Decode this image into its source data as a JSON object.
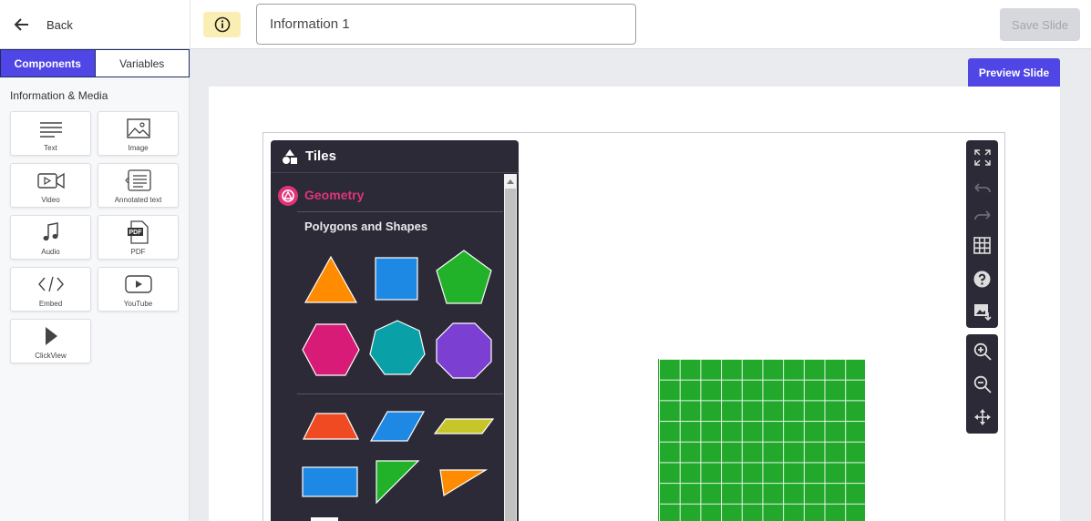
{
  "header": {
    "back_label": "Back",
    "title_value": "Information 1",
    "save_label": "Save Slide"
  },
  "sidebar": {
    "tabs": [
      {
        "label": "Components",
        "active": true
      },
      {
        "label": "Variables",
        "active": false
      }
    ],
    "section_title": "Information & Media",
    "components": [
      {
        "label": "Text",
        "icon": "text-lines-icon"
      },
      {
        "label": "Image",
        "icon": "image-icon"
      },
      {
        "label": "Video",
        "icon": "video-camera-icon"
      },
      {
        "label": "Annotated text",
        "icon": "annotated-text-icon"
      },
      {
        "label": "Audio",
        "icon": "music-note-icon"
      },
      {
        "label": "PDF",
        "icon": "pdf-file-icon"
      },
      {
        "label": "Embed",
        "icon": "code-icon"
      },
      {
        "label": "YouTube",
        "icon": "youtube-play-icon"
      },
      {
        "label": "ClickView",
        "icon": "play-triangle-icon"
      }
    ]
  },
  "canvas": {
    "preview_label": "Preview Slide"
  },
  "tiles": {
    "title": "Tiles",
    "category": "Geometry",
    "subcategory": "Polygons and Shapes",
    "colors": {
      "orange": "#ff8c00",
      "blue": "#1e88e5",
      "green": "#22b22a",
      "magenta": "#d81b76",
      "teal": "#0aa0a8",
      "purple": "#7b3fd1",
      "red_orange": "#f04a23",
      "yellow_green": "#c6c62a"
    }
  },
  "toolbar": {
    "buttons": [
      "fullscreen-icon",
      "undo-icon",
      "redo-icon",
      "grid-icon",
      "help-icon",
      "download-image-icon"
    ],
    "zoom_buttons": [
      "zoom-in-icon",
      "zoom-out-icon",
      "pan-icon"
    ]
  },
  "grid": {
    "color": "#22a82a"
  }
}
